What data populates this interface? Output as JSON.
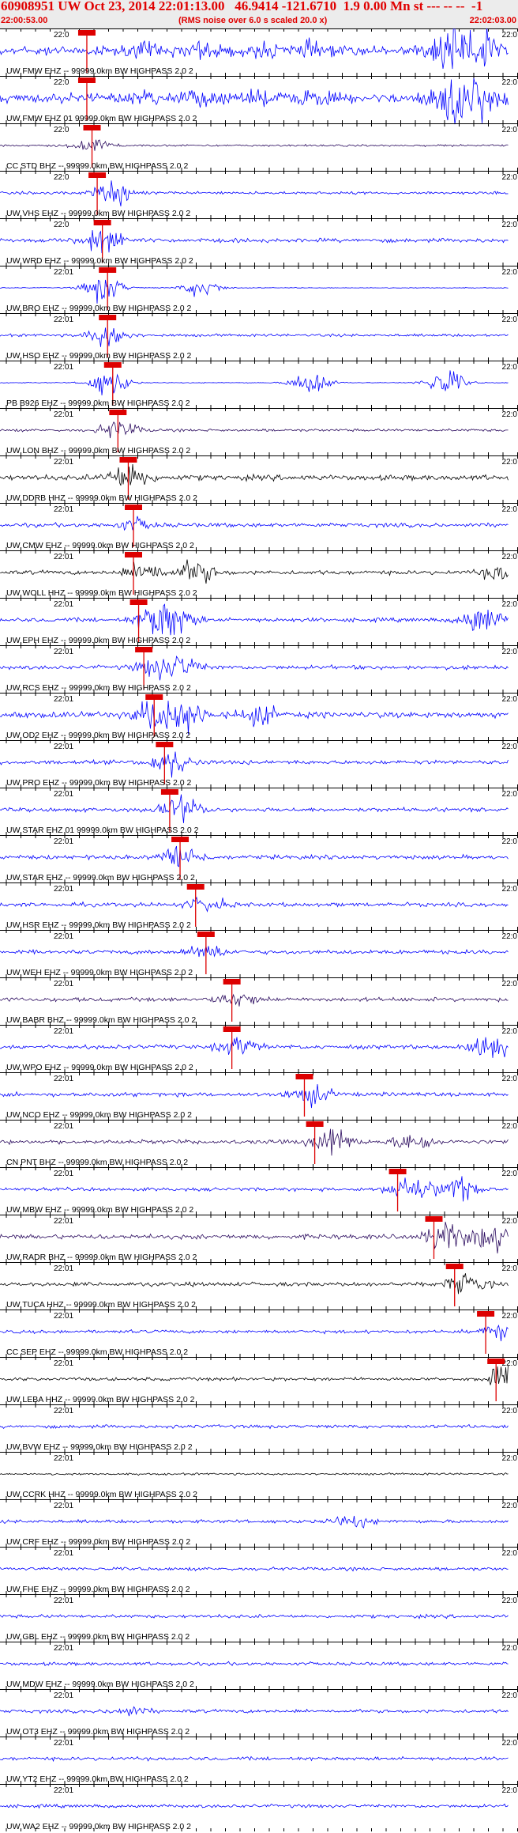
{
  "header": {
    "title": "60908951 UW Oct 23, 2014 22:01:13.00   46.9414 -121.6710  1.9 0.00 Mn st --- -- --  -1",
    "start_time": "22:00:53.00",
    "end_time": "22:02:03.00",
    "rms_note": "(RMS noise over 6.0 s scaled 20.0 x)"
  },
  "colors": {
    "title": "#e00000",
    "blue": "#0000ff",
    "black": "#000000",
    "navy": "#2a0a5e",
    "pick": "#dd0000"
  },
  "chart_data": {
    "type": "seismogram",
    "time_window": [
      "22:00:53.00",
      "22:02:03.00"
    ],
    "trace_time_label": "22:0",
    "tick_label_right": "22:0",
    "traces": [
      {
        "label": "UW FMW EHZ -- 99999.0km BW  HIGHPASS  2.0  2",
        "time_label": "22:0",
        "color": "blue",
        "pick": 0.16,
        "amp": 0.7,
        "bursts": [
          [
            0.28,
            0.3
          ],
          [
            0.39,
            0.4
          ],
          [
            0.5,
            0.3
          ],
          [
            0.6,
            0.35
          ],
          [
            0.86,
            1
          ],
          [
            0.9,
            1
          ],
          [
            0.93,
            0.9
          ]
        ]
      },
      {
        "label": "UW FMW EHZ 01 99999.0km BW  HIGHPASS  2.0  2",
        "time_label": "22:0",
        "color": "blue",
        "pick": 0.16,
        "amp": 0.7,
        "bursts": [
          [
            0.28,
            0.3
          ],
          [
            0.39,
            0.4
          ],
          [
            0.5,
            0.3
          ],
          [
            0.6,
            0.35
          ],
          [
            0.86,
            1
          ],
          [
            0.9,
            1
          ],
          [
            0.93,
            0.9
          ]
        ]
      },
      {
        "label": "CC STD BHZ -- 99999.0km BW  HIGHPASS  2.0  2",
        "time_label": "22:0",
        "color": "navy",
        "pick": 0.17,
        "amp": 0.15,
        "bursts": [
          [
            0.18,
            0.5
          ]
        ]
      },
      {
        "label": "UW VHS EHZ -- 99999.0km BW  HIGHPASS  2.0  2",
        "time_label": "22:0",
        "color": "blue",
        "pick": 0.18,
        "amp": 0.2,
        "bursts": [
          [
            0.22,
            0.8
          ]
        ]
      },
      {
        "label": "UW WRD EHZ -- 99999.0km BW  HIGHPASS  2.0  2",
        "time_label": "22:0",
        "color": "blue",
        "pick": 0.19,
        "amp": 0.3,
        "bursts": [
          [
            0.2,
            0.9
          ]
        ]
      },
      {
        "label": "UW BRO EHZ -- 99999.0km BW  HIGHPASS  2.0  2",
        "time_label": "22:01",
        "color": "blue",
        "pick": 0.2,
        "amp": 0.05,
        "bursts": [
          [
            0.2,
            1
          ],
          [
            0.39,
            0.6
          ]
        ]
      },
      {
        "label": "UW HSO EHZ -- 99999.0km BW  HIGHPASS  2.0  2",
        "time_label": "22:01",
        "color": "blue",
        "pick": 0.2,
        "amp": 0.2,
        "bursts": [
          [
            0.21,
            0.8
          ]
        ]
      },
      {
        "label": "PB B926 EHZ -- 99999.0km BW  HIGHPASS  2.0  2",
        "time_label": "22:01",
        "color": "blue",
        "pick": 0.21,
        "amp": 0.05,
        "bursts": [
          [
            0.21,
            1
          ],
          [
            0.6,
            0.9
          ],
          [
            0.86,
            1
          ]
        ]
      },
      {
        "label": "UW LON BHZ -- 99999.0km BW  HIGHPASS  2.0  2",
        "time_label": "22:01",
        "color": "navy",
        "pick": 0.22,
        "amp": 0.2,
        "bursts": [
          [
            0.23,
            0.7
          ]
        ]
      },
      {
        "label": "UW DDRB HHZ -- 99999.0km BW  HIGHPASS  2.0  2",
        "time_label": "22:01",
        "color": "black",
        "pick": 0.24,
        "amp": 0.4,
        "bursts": [
          [
            0.25,
            1
          ]
        ]
      },
      {
        "label": "UW CMW EHZ -- 99999.0km BW  HIGHPASS  2.0  2",
        "time_label": "22:01",
        "color": "blue",
        "pick": 0.25,
        "amp": 0.3,
        "bursts": [
          [
            0.26,
            0.4
          ]
        ]
      },
      {
        "label": "UW WOLL HHZ -- 99999.0km BW  HIGHPASS  2.0  2",
        "time_label": "22:01",
        "color": "black",
        "pick": 0.25,
        "amp": 0.3,
        "bursts": [
          [
            0.28,
            0.7
          ],
          [
            0.38,
            0.8
          ],
          [
            0.97,
            0.6
          ]
        ]
      },
      {
        "label": "UW EPH EHZ -- 99999.0km BW  HIGHPASS  2.0  2",
        "time_label": "22:01",
        "color": "blue",
        "pick": 0.26,
        "amp": 0.3,
        "bursts": [
          [
            0.3,
            1
          ],
          [
            0.34,
            0.9
          ],
          [
            0.93,
            1
          ]
        ]
      },
      {
        "label": "UW RCS EHZ -- 99999.0km BW  HIGHPASS  2.0  2",
        "time_label": "22:01",
        "color": "blue",
        "pick": 0.27,
        "amp": 0.3,
        "bursts": [
          [
            0.3,
            0.6
          ],
          [
            0.35,
            0.7
          ]
        ]
      },
      {
        "label": "UW OD2 EHZ -- 99999.0km BW  HIGHPASS  2.0  2",
        "time_label": "22:01",
        "color": "blue",
        "pick": 0.29,
        "amp": 0.45,
        "bursts": [
          [
            0.3,
            1
          ],
          [
            0.36,
            1
          ],
          [
            0.5,
            0.6
          ]
        ]
      },
      {
        "label": "UW PRO EHZ -- 99999.0km BW  HIGHPASS  2.0  2",
        "time_label": "22:01",
        "color": "blue",
        "pick": 0.31,
        "amp": 0.3,
        "bursts": [
          [
            0.33,
            0.9
          ]
        ]
      },
      {
        "label": "UW STAR EHZ 01 99999.0km BW  HIGHPASS  2.0  2",
        "time_label": "22:01",
        "color": "blue",
        "pick": 0.32,
        "amp": 0.3,
        "bursts": [
          [
            0.35,
            0.9
          ]
        ]
      },
      {
        "label": "UW STAR EHZ -- 99999.0km BW  HIGHPASS  2.0  2",
        "time_label": "22:01",
        "color": "blue",
        "pick": 0.34,
        "amp": 0.3,
        "bursts": [
          [
            0.35,
            0.9
          ]
        ]
      },
      {
        "label": "UW HSR EHZ -- 99999.0km BW  HIGHPASS  2.0  2",
        "time_label": "22:01",
        "color": "blue",
        "pick": 0.37,
        "amp": 0.3,
        "bursts": [
          [
            0.4,
            0.5
          ]
        ]
      },
      {
        "label": "UW WEH EHZ -- 99999.0km BW  HIGHPASS  2.0  2",
        "time_label": "22:01",
        "color": "blue",
        "pick": 0.39,
        "amp": 0.3,
        "bursts": [
          [
            0.4,
            0.5
          ]
        ]
      },
      {
        "label": "UW BABR BHZ -- 99999.0km BW  HIGHPASS  2.0  2",
        "time_label": "22:01",
        "color": "navy",
        "pick": 0.44,
        "amp": 0.3,
        "bursts": [
          [
            0.46,
            0.5
          ]
        ]
      },
      {
        "label": "UW WPO EHZ -- 99999.0km BW  HIGHPASS  2.0  2",
        "time_label": "22:01",
        "color": "blue",
        "pick": 0.44,
        "amp": 0.3,
        "bursts": [
          [
            0.46,
            0.6
          ],
          [
            0.94,
            1
          ]
        ]
      },
      {
        "label": "UW NCO EHZ -- 99999.0km BW  HIGHPASS  2.0  2",
        "time_label": "22:01",
        "color": "blue",
        "pick": 0.58,
        "amp": 0.3,
        "bursts": [
          [
            0.6,
            0.7
          ]
        ]
      },
      {
        "label": "CN PNT BHZ -- 99999.0km BW  HIGHPASS  2.0  2",
        "time_label": "22:01",
        "color": "navy",
        "pick": 0.6,
        "amp": 0.3,
        "bursts": [
          [
            0.64,
            1
          ],
          [
            0.8,
            0.7
          ]
        ]
      },
      {
        "label": "UW MBW EHZ -- 99999.0km BW  HIGHPASS  2.0  2",
        "time_label": "22:01",
        "color": "blue",
        "pick": 0.76,
        "amp": 0.25,
        "bursts": [
          [
            0.79,
            1
          ],
          [
            0.88,
            1
          ]
        ]
      },
      {
        "label": "UW RADR BHZ -- 99999.0km BW  HIGHPASS  2.0  2",
        "time_label": "22:01",
        "color": "navy",
        "pick": 0.83,
        "amp": 0.35,
        "bursts": [
          [
            0.86,
            1
          ],
          [
            0.95,
            1
          ]
        ]
      },
      {
        "label": "UW TUCA HHZ -- 99999.0km BW  HIGHPASS  2.0  2",
        "time_label": "22:01",
        "color": "black",
        "pick": 0.87,
        "amp": 0.3,
        "bursts": [
          [
            0.9,
            0.7
          ]
        ]
      },
      {
        "label": "CC SEP EHZ -- 99999.0km BW  HIGHPASS  2.0  2",
        "time_label": "22:01",
        "color": "blue",
        "pick": 0.93,
        "amp": 0.25,
        "bursts": [
          [
            0.97,
            0.6
          ]
        ]
      },
      {
        "label": "UW LEBA HHZ -- 99999.0km BW  HIGHPASS  2.0  2",
        "time_label": "22:01",
        "color": "black",
        "pick": 0.95,
        "amp": 0.25,
        "bursts": [
          [
            0.98,
            1
          ]
        ]
      },
      {
        "label": "UW BVW EHZ -- 99999.0km BW  HIGHPASS  2.0  2",
        "time_label": "22:01",
        "color": "blue",
        "pick": null,
        "amp": 0.25,
        "bursts": []
      },
      {
        "label": "UW CCRK HHZ -- 99999.0km BW  HIGHPASS  2.0  2",
        "time_label": "22:01",
        "color": "black",
        "pick": null,
        "amp": 0.15,
        "bursts": []
      },
      {
        "label": "UW CRF EHZ -- 99999.0km BW  HIGHPASS  2.0  2",
        "time_label": "22:01",
        "color": "blue",
        "pick": null,
        "amp": 0.25,
        "bursts": [
          [
            0.68,
            0.4
          ]
        ]
      },
      {
        "label": "UW FHE EHZ -- 99999.0km BW  HIGHPASS  2.0  2",
        "time_label": "22:01",
        "color": "blue",
        "pick": null,
        "amp": 0.25,
        "bursts": []
      },
      {
        "label": "UW GBL EHZ -- 99999.0km BW  HIGHPASS  2.0  2",
        "time_label": "22:01",
        "color": "blue",
        "pick": null,
        "amp": 0.25,
        "bursts": []
      },
      {
        "label": "UW MDW EHZ -- 99999.0km BW  HIGHPASS  2.0  2",
        "time_label": "22:01",
        "color": "blue",
        "pick": null,
        "amp": 0.25,
        "bursts": []
      },
      {
        "label": "UW OT3 EHZ -- 99999.0km BW  HIGHPASS  2.0  2",
        "time_label": "22:01",
        "color": "blue",
        "pick": null,
        "amp": 0.25,
        "bursts": [
          [
            0.25,
            0.3
          ]
        ]
      },
      {
        "label": "UW YT2 EHZ -- 99999.0km BW  HIGHPASS  2.0  2",
        "time_label": "22:01",
        "color": "blue",
        "pick": null,
        "amp": 0.25,
        "bursts": []
      },
      {
        "label": "UW WA2 EHZ -- 99999.0km BW  HIGHPASS  2.0  2",
        "time_label": "22:01",
        "color": "blue",
        "pick": null,
        "amp": 0.25,
        "bursts": []
      }
    ]
  }
}
